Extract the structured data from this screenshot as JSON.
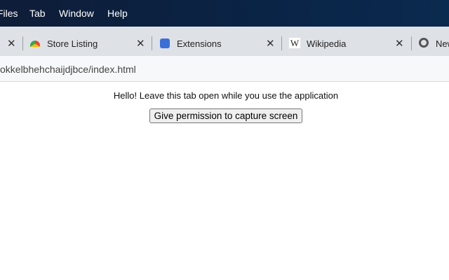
{
  "menubar": {
    "items": [
      "Files",
      "Tab",
      "Window",
      "Help"
    ]
  },
  "tabs": [
    {
      "label": "Store Listing",
      "icon": "webstore-icon"
    },
    {
      "label": "Extensions",
      "icon": "puzzle-icon"
    },
    {
      "label": "Wikipedia",
      "icon": "wikipedia-icon"
    },
    {
      "label": "New",
      "icon": "chrome-icon"
    }
  ],
  "close_glyph": "✕",
  "address": {
    "url": "okkelbhehchaijdjbce/index.html"
  },
  "content": {
    "message": "Hello! Leave this tab open while you use the application",
    "button": "Give permission to capture screen"
  }
}
